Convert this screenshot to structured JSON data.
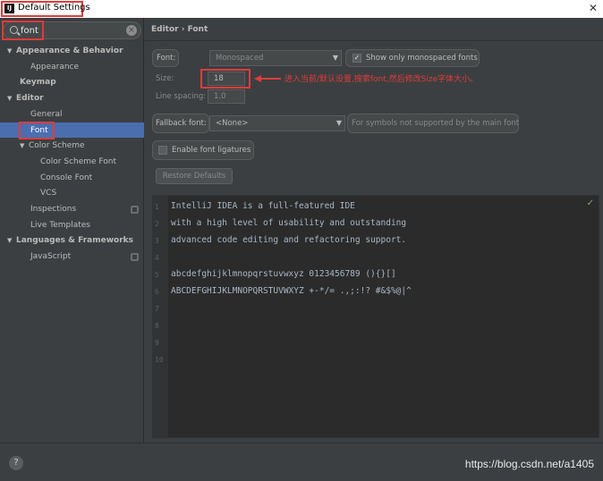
{
  "window": {
    "title": "Default Settings",
    "close_glyph": "✕",
    "logo_glyph": "IJ",
    "logo_icon": "intellij-logo-icon"
  },
  "sidebar": {
    "search": {
      "value": "font",
      "clear_glyph": "×"
    },
    "items": [
      {
        "label": "Appearance & Behavior",
        "arrow": "▼",
        "bold": true
      },
      {
        "label": "Appearance"
      },
      {
        "label": "Keymap",
        "bold": true
      },
      {
        "label": "Editor",
        "arrow": "▼",
        "bold": true
      },
      {
        "label": "General"
      },
      {
        "label": "Font",
        "selected": true
      },
      {
        "label": "Color Scheme",
        "arrow": "▼"
      },
      {
        "label": "Color Scheme Font"
      },
      {
        "label": "Console Font"
      },
      {
        "label": "VCS"
      },
      {
        "label": "Inspections",
        "icon": "gear-icon"
      },
      {
        "label": "Live Templates"
      },
      {
        "label": "Languages & Frameworks",
        "arrow": "▼",
        "bold": true
      },
      {
        "label": "JavaScript",
        "icon": "gear-icon"
      }
    ],
    "help_glyph": "?"
  },
  "main": {
    "breadcrumb": "Editor › Font",
    "font_label": "Font:",
    "font_value": "Monospaced",
    "show_monospaced_label": "Show only monospaced fonts",
    "show_monospaced_checked": true,
    "size_label": "Size:",
    "size_value": "18",
    "line_spacing_label": "Line spacing:",
    "line_spacing_value": "1.0",
    "annotation": "进入当前/默认设置,搜索font,然后修改Size字体大小。",
    "fallback_label": "Fallback font:",
    "fallback_value": "<None>",
    "fallback_hint": "For symbols not supported by the main font",
    "ligatures_label": "Enable font ligatures",
    "ligatures_checked": false,
    "restore_button": "Restore Defaults",
    "combo_arrow": "▼",
    "check_glyph": "✓",
    "preview_lines": [
      "IntelliJ IDEA is a full-featured IDE",
      "with a high level of usability and outstanding",
      "advanced code editing and refactoring support.",
      "",
      "abcdefghijklmnopqrstuvwxyz 0123456789 (){}[]",
      "ABCDEFGHIJKLMNOPQRSTUVWXYZ +-*/= .,;:!? #&$%@|^"
    ],
    "line_numbers": [
      "1",
      "2",
      "3",
      "4",
      "5",
      "6",
      "7",
      "8",
      "9",
      "10"
    ],
    "preview_ok_glyph": "✓"
  },
  "watermark": "https://blog.csdn.net/a1405"
}
